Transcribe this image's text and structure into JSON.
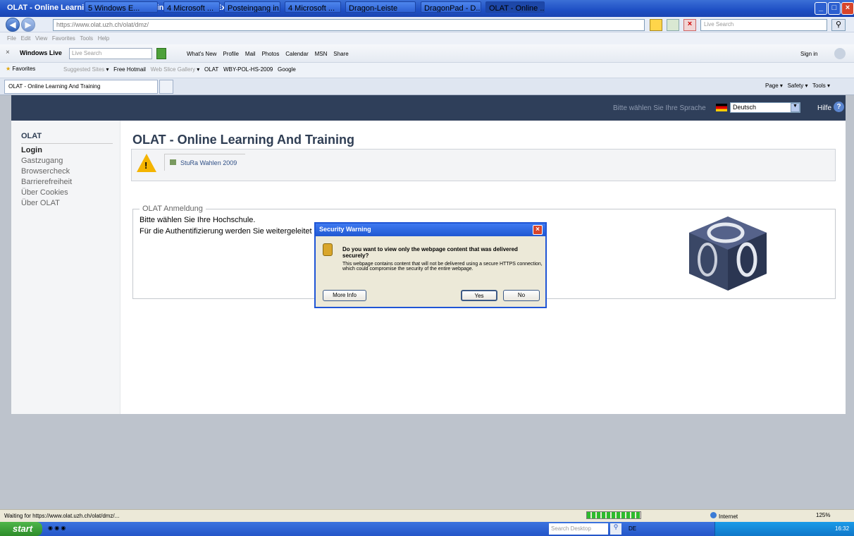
{
  "window": {
    "title": "OLAT - Online Learning And Training - Windows Internet Explorer"
  },
  "browser": {
    "address": "https://www.olat.uzh.ch/olat/dmz/",
    "search_placeholder": "Live Search",
    "menu": [
      "File",
      "Edit",
      "View",
      "Favorites",
      "Tools",
      "Help"
    ],
    "toolbar": {
      "brand": "Windows Live",
      "search_placeholder": "Live Search",
      "links": [
        "What's New",
        "Profile",
        "Mail",
        "Photos",
        "Calendar",
        "MSN",
        "Share"
      ],
      "signin": "Sign in"
    },
    "favorites": {
      "label": "Favorites",
      "items": [
        "Suggested Sites",
        "Free Hotmail",
        "Web Slice Gallery",
        "OLAT",
        "WBY-POL-HS-2009",
        "Google"
      ]
    },
    "tab_label": "OLAT - Online Learning And Training",
    "command_bar": [
      "Page",
      "Safety",
      "Tools"
    ]
  },
  "page": {
    "topnav": {
      "language_prompt": "Bitte wählen Sie Ihre Sprache",
      "language_value": "Deutsch",
      "help": "Hilfe"
    },
    "sidebar": {
      "title": "OLAT",
      "active": "Login",
      "items": [
        "Gastzugang",
        "Browsercheck",
        "Barrierefreiheit",
        "Über Cookies",
        "Über OLAT"
      ]
    },
    "heading": "OLAT - Online Learning And Training",
    "notice": "StuRa Wahlen 2009",
    "anmeldung": {
      "legend": "OLAT Anmeldung",
      "line1": "Bitte wählen Sie Ihre Hochschule.",
      "line2": "Für die Authentifizierung werden Sie weitergeleitet"
    }
  },
  "dialog": {
    "title": "Security Warning",
    "question": "Do you want to view only the webpage content that was delivered securely?",
    "detail": "This webpage contains content that will not be delivered using a secure HTTPS connection, which could compromise the security of the entire webpage.",
    "more_info": "More Info",
    "yes": "Yes",
    "no": "No"
  },
  "status": {
    "text": "Waiting for https://www.olat.uzh.ch/olat/dmz/...",
    "zone": "Internet",
    "zoom": "125%"
  },
  "taskbar": {
    "start": "start",
    "tasks": [
      "5 Windows E...",
      "4 Microsoft ...",
      "Posteingang in...",
      "4 Microsoft ...",
      "Dragon-Leiste",
      "DragonPad - D...",
      "OLAT - Online ..."
    ],
    "search_placeholder": "Search Desktop",
    "lang": "DE",
    "clock": "16:32"
  },
  "colors": {
    "accent": "#1f55d5",
    "nav": "#2f3f5a",
    "heading": "#2f3e54"
  }
}
